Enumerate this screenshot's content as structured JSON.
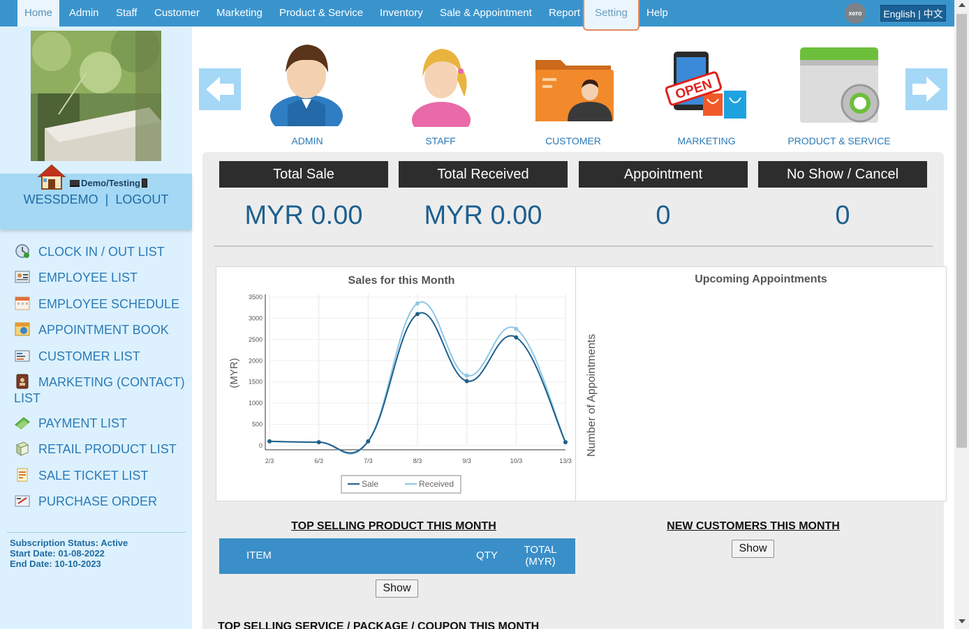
{
  "nav": {
    "items": [
      "Home",
      "Admin",
      "Staff",
      "Customer",
      "Marketing",
      "Product & Service",
      "Inventory",
      "Sale & Appointment",
      "Report",
      "Setting",
      "Help"
    ],
    "xero": "xero",
    "language": "English | 中文"
  },
  "sidebar": {
    "demo_label": "Demo/Testing",
    "username": "WESSDEMO",
    "separator": "|",
    "logout": "LOGOUT",
    "menu": [
      {
        "label": "CLOCK IN / OUT LIST",
        "icon": "clock-icon"
      },
      {
        "label": "EMPLOYEE LIST",
        "icon": "employee-card-icon"
      },
      {
        "label": "EMPLOYEE SCHEDULE",
        "icon": "calendar-icon"
      },
      {
        "label": "APPOINTMENT BOOK",
        "icon": "appointment-book-icon"
      },
      {
        "label": "CUSTOMER LIST",
        "icon": "customer-card-icon"
      },
      {
        "label": "MARKETING (CONTACT) LIST",
        "icon": "contact-book-icon"
      },
      {
        "label": "PAYMENT LIST",
        "icon": "money-icon"
      },
      {
        "label": "RETAIL PRODUCT LIST",
        "icon": "product-box-icon"
      },
      {
        "label": "SALE TICKET LIST",
        "icon": "receipt-icon"
      },
      {
        "label": "PURCHASE ORDER",
        "icon": "purchase-order-icon"
      }
    ],
    "subscription": {
      "status": "Subscription Status: Active",
      "start": "Start Date: 01-08-2022",
      "end": "End Date: 10-10-2023"
    }
  },
  "carousel": {
    "items": [
      "ADMIN",
      "STAFF",
      "CUSTOMER",
      "MARKETING",
      "PRODUCT & SERVICE"
    ]
  },
  "stats": [
    {
      "label": "Total Sale",
      "value": "MYR 0.00"
    },
    {
      "label": "Total Received",
      "value": "MYR 0.00"
    },
    {
      "label": "Appointment",
      "value": "0"
    },
    {
      "label": "No Show / Cancel",
      "value": "0"
    }
  ],
  "colors": {
    "nav_bg": "#3a94cc",
    "sidebar_bg": "#dcf1fd",
    "sale_line": "#1f5f8b",
    "received_line": "#8ec7e3"
  },
  "appointments": {
    "title": "Upcoming Appointments",
    "ylabel": "Number of Appointments"
  },
  "top_products": {
    "title": "TOP SELLING PRODUCT THIS MONTH",
    "columns": [
      "ITEM",
      "QTY",
      "TOTAL (MYR)"
    ],
    "show": "Show"
  },
  "new_customers": {
    "title": "NEW CUSTOMERS THIS MONTH",
    "show": "Show"
  },
  "top_services": {
    "title": "TOP SELLING SERVICE / PACKAGE / COUPON THIS MONTH"
  },
  "chart_data": {
    "type": "line",
    "title": "Sales for this Month",
    "xlabel": "",
    "ylabel": "(MYR)",
    "categories": [
      "2/3",
      "6/3",
      "7/3",
      "8/3",
      "9/3",
      "10/3",
      "13/3"
    ],
    "ylim": [
      0,
      3500
    ],
    "yticks": [
      0,
      500,
      1000,
      1500,
      2000,
      2500,
      3000,
      3500
    ],
    "grid": true,
    "legend": "bottom",
    "series": [
      {
        "name": "Sale",
        "values": [
          100,
          80,
          100,
          3100,
          1520,
          2550,
          80
        ]
      },
      {
        "name": "Received",
        "values": [
          100,
          80,
          100,
          3350,
          1650,
          2750,
          80
        ]
      }
    ]
  }
}
